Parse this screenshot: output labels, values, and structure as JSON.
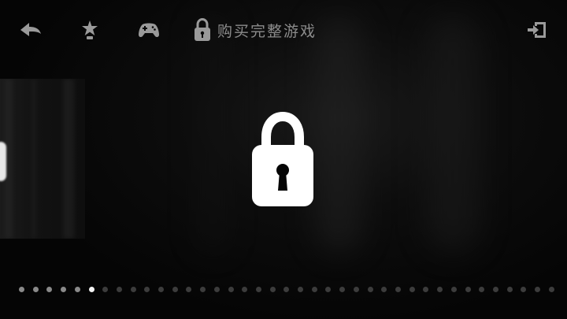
{
  "toolbar": {
    "back_icon": "back-arrow-icon",
    "star_icon": "star-icon",
    "controller_icon": "gamepad-icon",
    "buy_icon": "lock-icon",
    "buy_label": "购买完整游戏",
    "exit_icon": "exit-icon"
  },
  "level": {
    "locked": true,
    "lock_icon": "padlock-icon"
  },
  "pager": {
    "total_pages": 39,
    "current_page": 6
  },
  "colors": {
    "background": "#050505",
    "icon": "#9a9a9a",
    "lock": "#ffffff",
    "dot_inactive": "#3c3c3c",
    "dot_visited": "#8a8a8a",
    "dot_current": "#f4f4f4"
  }
}
